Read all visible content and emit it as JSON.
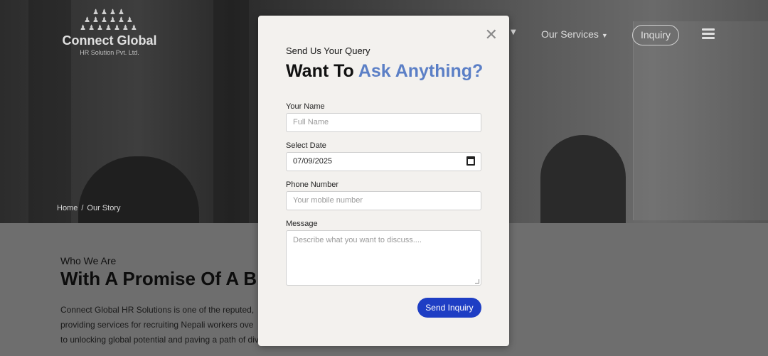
{
  "header": {
    "logo_title": "Connect Global",
    "logo_sub": "HR Solution Pvt. Ltd.",
    "nav_services": "Our Services",
    "nav_inquiry": "Inquiry"
  },
  "breadcrumb": {
    "home": "Home",
    "sep": "/",
    "current": "Our Story"
  },
  "about": {
    "kicker": "Who We Are",
    "title": "With A Promise Of A Bright",
    "lines": [
      "Connect Global HR Solutions is one of the reputed,",
      "providing services for recruiting Nepali workers ove",
      "to unlocking global potential and paving a path of div"
    ]
  },
  "modal": {
    "kicker": "Send Us Your Query",
    "title_plain": "Want To ",
    "title_accent": "Ask Anything?",
    "close_symbol": "✕",
    "name_label": "Your Name",
    "name_placeholder": "Full Name",
    "date_label": "Select Date",
    "date_value": "07/09/2025",
    "phone_label": "Phone Number",
    "phone_placeholder": "Your mobile number",
    "message_label": "Message",
    "message_placeholder": "Describe what you want to discuss....",
    "submit_label": "Send Inquiry"
  },
  "colors": {
    "accent": "#5b7fc6",
    "button": "#1e3ec4"
  }
}
